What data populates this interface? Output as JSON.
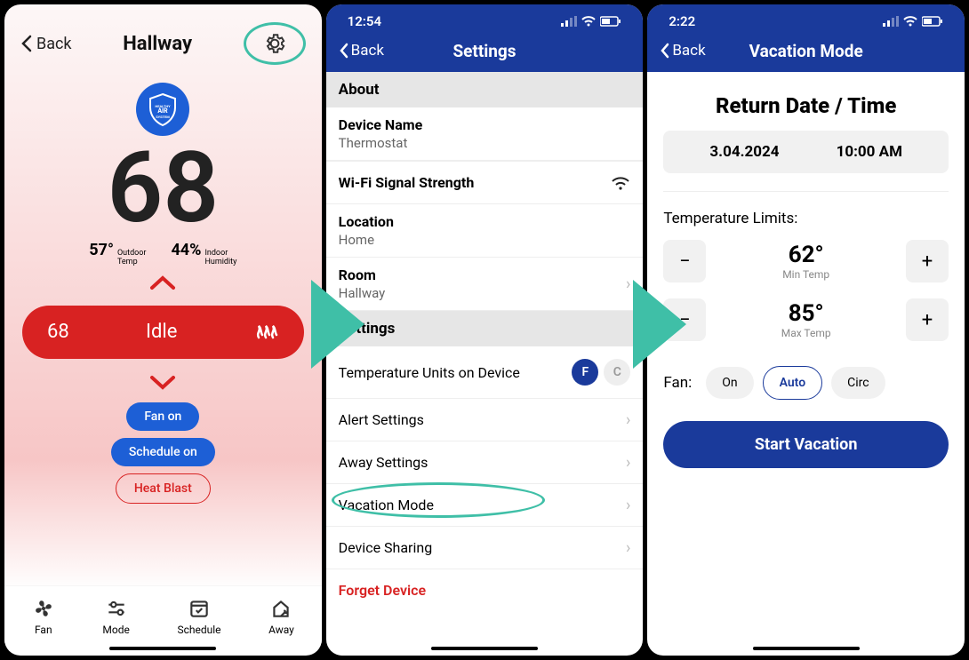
{
  "colors": {
    "brand_blue": "#1a3a9b",
    "accent_red": "#d82222",
    "highlight": "#3fbfa7"
  },
  "phone1": {
    "back_label": "Back",
    "title": "Hallway",
    "shield_text": "HEALTHY AIR SYSTEM",
    "main_temp": "68",
    "outdoor_temp": "57°",
    "outdoor_label": "Outdoor\nTemp",
    "humidity": "44%",
    "humidity_label": "Indoor\nHumidity",
    "setpoint": "68",
    "status": "Idle",
    "fan_pill": "Fan on",
    "schedule_pill": "Schedule on",
    "heatblast_pill": "Heat Blast",
    "nav": {
      "fan": "Fan",
      "mode": "Mode",
      "schedule": "Schedule",
      "away": "Away"
    }
  },
  "phone2": {
    "time": "12:54",
    "back_label": "Back",
    "title": "Settings",
    "about_header": "About",
    "device_name_label": "Device Name",
    "device_name_value": "Thermostat",
    "wifi_label": "Wi-Fi Signal Strength",
    "location_label": "Location",
    "location_value": "Home",
    "room_label": "Room",
    "room_value": "Hallway",
    "settings_header": "Settings",
    "temp_units_label": "Temperature Units on Device",
    "unit_f": "F",
    "unit_c": "C",
    "alert_settings": "Alert Settings",
    "away_settings": "Away Settings",
    "vacation_mode": "Vacation Mode",
    "device_sharing": "Device Sharing",
    "forget_device": "Forget Device"
  },
  "phone3": {
    "time": "2:22",
    "back_label": "Back",
    "title": "Vacation Mode",
    "heading": "Return Date / Time",
    "date": "3.04.2024",
    "time_value": "10:00 AM",
    "temp_limits_label": "Temperature Limits:",
    "min_temp": "62°",
    "min_label": "Min Temp",
    "max_temp": "85°",
    "max_label": "Max Temp",
    "fan_label": "Fan:",
    "fan_on": "On",
    "fan_auto": "Auto",
    "fan_circ": "Circ",
    "start_button": "Start Vacation"
  }
}
